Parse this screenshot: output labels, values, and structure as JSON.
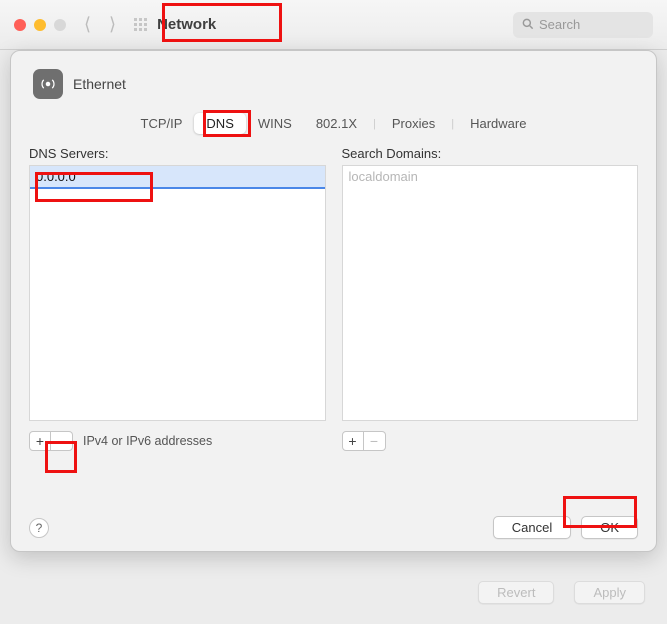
{
  "window": {
    "title": "Network",
    "search_placeholder": "Search"
  },
  "sheet": {
    "interface": "Ethernet",
    "tabs": [
      "TCP/IP",
      "DNS",
      "WINS",
      "802.1X",
      "Proxies",
      "Hardware"
    ],
    "active_tab": "DNS",
    "dns": {
      "label": "DNS Servers:",
      "editing_value": "0.0.0.0",
      "hint": "IPv4 or IPv6 addresses"
    },
    "search_domains": {
      "label": "Search Domains:",
      "items": [
        "localdomain"
      ]
    },
    "buttons": {
      "help": "?",
      "cancel": "Cancel",
      "ok": "OK"
    }
  },
  "behind_footer": {
    "revert": "Revert",
    "apply": "Apply"
  },
  "icons": {
    "plus": "+",
    "minus": "−"
  }
}
